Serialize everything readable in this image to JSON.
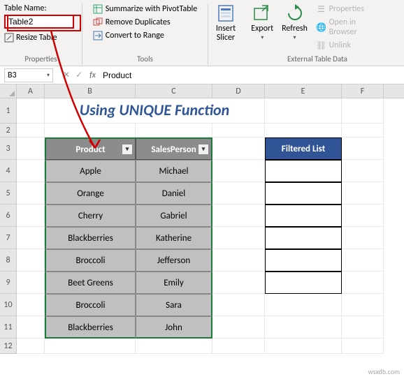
{
  "ribbon": {
    "table_name_label": "Table Name:",
    "table_name_value": "Table2",
    "resize_table": "Resize Table",
    "properties_group": "Properties",
    "tools": {
      "pivot": "Summarize with PivotTable",
      "dupes": "Remove Duplicates",
      "range": "Convert to Range",
      "group": "Tools"
    },
    "insert_slicer": "Insert\nSlicer",
    "export": "Export",
    "refresh": "Refresh",
    "ext": {
      "props": "Properties",
      "browser": "Open in Browser",
      "unlink": "Unlink",
      "group": "External Table Data"
    }
  },
  "namebox": {
    "ref": "B3",
    "fx": "fx",
    "formula": "Product"
  },
  "columns": [
    "A",
    "B",
    "C",
    "D",
    "E",
    "F"
  ],
  "row_numbers": [
    "1",
    "2",
    "3",
    "4",
    "5",
    "6",
    "7",
    "8",
    "9",
    "10",
    "11",
    "12"
  ],
  "title": "Using UNIQUE Function",
  "table": {
    "headers": [
      "Product",
      "SalesPerson"
    ],
    "rows": [
      [
        "Apple",
        "Michael"
      ],
      [
        "Orange",
        "Daniel"
      ],
      [
        "Cherry",
        "Gabriel"
      ],
      [
        "Blackberries",
        "Katherine"
      ],
      [
        "Broccoli",
        "Jefferson"
      ],
      [
        "Beet Greens",
        "Emily"
      ],
      [
        "Broccoli",
        "Sara"
      ],
      [
        "Blackberries",
        "John"
      ]
    ]
  },
  "filtered_header": "Filtered List",
  "watermark": "wsxdb.com"
}
